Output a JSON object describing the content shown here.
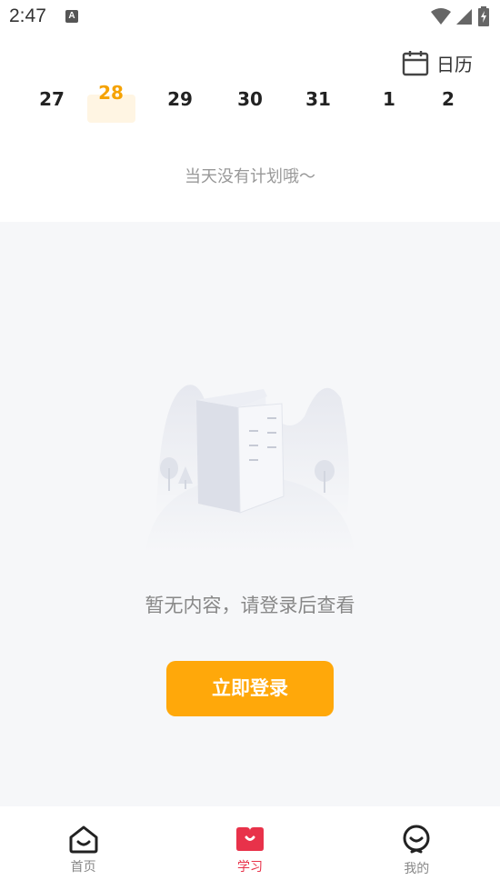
{
  "status_bar": {
    "time": "2:47",
    "notification_letter": "A"
  },
  "header": {
    "calendar_label": "日历"
  },
  "date_strip": {
    "dates": [
      "27",
      "28",
      "29",
      "30",
      "31",
      "1",
      "2"
    ],
    "selected_index": 1
  },
  "plan": {
    "empty_text": "当天没有计划哦～"
  },
  "content": {
    "empty_text": "暂无内容，请登录后查看",
    "login_button": "立即登录"
  },
  "tab_bar": {
    "tabs": [
      {
        "label": "首页",
        "icon": "home-icon",
        "active": false
      },
      {
        "label": "学习",
        "icon": "study-icon",
        "active": true
      },
      {
        "label": "我的",
        "icon": "profile-icon",
        "active": false
      }
    ]
  },
  "colors": {
    "accent": "#ffa80a",
    "active_tab": "#e8324a",
    "background": "#f6f7f9"
  }
}
